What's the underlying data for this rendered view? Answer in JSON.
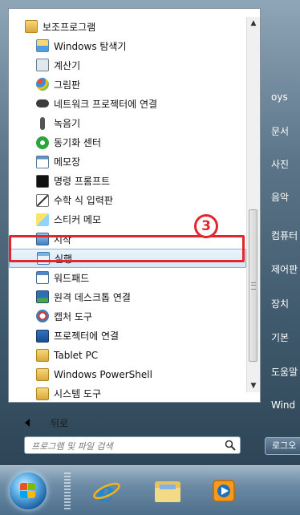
{
  "programs": [
    {
      "label": "보조프로그램",
      "icon": "folder-icon",
      "indent": false
    },
    {
      "label": "Windows 탐색기",
      "icon": "explorer-icon",
      "indent": true
    },
    {
      "label": "계산기",
      "icon": "calculator-icon",
      "indent": true
    },
    {
      "label": "그림판",
      "icon": "paint-icon",
      "indent": true
    },
    {
      "label": "네트워크 프로젝터에 연결",
      "icon": "network-projector-icon",
      "indent": true
    },
    {
      "label": "녹음기",
      "icon": "microphone-icon",
      "indent": true
    },
    {
      "label": "동기화 센터",
      "icon": "sync-center-icon",
      "indent": true
    },
    {
      "label": "메모장",
      "icon": "notepad-icon",
      "indent": true
    },
    {
      "label": "명령 프롬프트",
      "icon": "command-prompt-icon",
      "indent": true
    },
    {
      "label": "수학 식 입력판",
      "icon": "math-input-icon",
      "indent": true
    },
    {
      "label": "스티커 메모",
      "icon": "sticky-notes-icon",
      "indent": true
    },
    {
      "label": "시작",
      "icon": "getting-started-icon",
      "indent": true
    },
    {
      "label": "실행",
      "icon": "run-icon",
      "indent": true,
      "selected": true
    },
    {
      "label": "워드패드",
      "icon": "wordpad-icon",
      "indent": true
    },
    {
      "label": "원격 데스크톱 연결",
      "icon": "remote-desktop-icon",
      "indent": true
    },
    {
      "label": "캡처 도구",
      "icon": "snipping-tool-icon",
      "indent": true
    },
    {
      "label": "프로젝터에 연결",
      "icon": "projector-icon",
      "indent": true
    },
    {
      "label": "Tablet PC",
      "icon": "folder-icon",
      "indent": true
    },
    {
      "label": "Windows PowerShell",
      "icon": "folder-icon",
      "indent": true
    },
    {
      "label": "시스템 도구",
      "icon": "folder-icon",
      "indent": true
    }
  ],
  "callout": {
    "label": "3"
  },
  "back": {
    "label": "뒤로"
  },
  "search": {
    "placeholder": "프로그램 및 파일 검색"
  },
  "right_panel": {
    "items": [
      {
        "label": "oys"
      },
      {
        "label": "문서"
      },
      {
        "label": "사진"
      },
      {
        "label": "음악"
      },
      {
        "label": "컴퓨터"
      },
      {
        "label": "제어판"
      },
      {
        "label": "장치"
      },
      {
        "label": "기본"
      },
      {
        "label": "도움말"
      },
      {
        "label": "Wind"
      }
    ]
  },
  "shutdown": {
    "label": "로그오"
  },
  "colors": {
    "highlight": "#e2262e",
    "selection": "#d4e8f8",
    "menu_bg": "#4e6a80"
  }
}
